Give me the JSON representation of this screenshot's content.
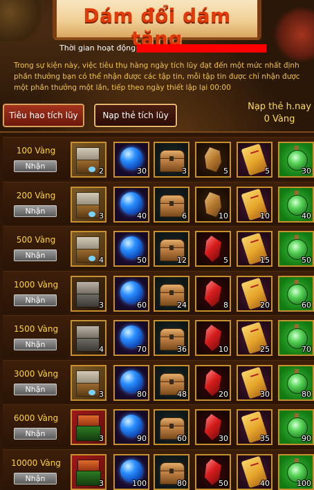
{
  "header": {
    "title": "Dám đổi dám tặng",
    "time_label": "Thời gian hoạt động:",
    "time_value": "",
    "description": "Trong sự kiện này, việc tiêu thụ hàng ngày tích lũy đạt đến một mức nhất định phần thưởng bạn có thể nhận được các tập tin, mỗi tập tin được chỉ nhận được một phần thưởng một lần, tiếp theo ngày thiết lập lại 00:00"
  },
  "tabs": [
    {
      "label": "Tiêu hao tích lũy",
      "active": false
    },
    {
      "label": "Nạp thẻ tích lũy",
      "active": true
    }
  ],
  "nap_info": {
    "line1": "Nạp thẻ h.nay",
    "line2": "0 Vàng"
  },
  "colors": {
    "amount": "#ffd33a",
    "desc": "#f0c24b",
    "title": "#e23b0b",
    "slot_border": "#c9912e"
  },
  "rows": [
    {
      "amount": "100 Vàng",
      "button": "Nhận",
      "counts": [
        "2",
        "30",
        "3",
        "5",
        "5",
        "30"
      ]
    },
    {
      "amount": "200 Vàng",
      "button": "Nhận",
      "counts": [
        "3",
        "40",
        "6",
        "10",
        "10",
        "40"
      ]
    },
    {
      "amount": "500 Vàng",
      "button": "Nhận",
      "counts": [
        "4",
        "50",
        "12",
        "5",
        "15",
        "50"
      ]
    },
    {
      "amount": "1000 Vàng",
      "button": "Nhận",
      "counts": [
        "3",
        "60",
        "24",
        "8",
        "20",
        "60"
      ]
    },
    {
      "amount": "1500 Vàng",
      "button": "Nhận",
      "counts": [
        "4",
        "70",
        "36",
        "10",
        "25",
        "70"
      ]
    },
    {
      "amount": "3000 Vàng",
      "button": "Nhận",
      "counts": [
        "3",
        "80",
        "48",
        "20",
        "30",
        "80"
      ]
    },
    {
      "amount": "6000 Vàng",
      "button": "Nhận",
      "counts": [
        "3",
        "90",
        "60",
        "30",
        "35",
        "90"
      ]
    },
    {
      "amount": "10000 Vàng",
      "button": "Nhận",
      "counts": [
        "3",
        "100",
        "80",
        "50",
        "40",
        "100"
      ]
    }
  ],
  "row_icons": [
    [
      "gift-box-icon",
      "blue-orb-icon",
      "treasure-chest-icon",
      "amber-stone-icon",
      "scroll-icon",
      "green-potion-icon"
    ],
    [
      "gift-box-icon",
      "blue-orb-icon",
      "treasure-chest-icon",
      "amber-stone-icon",
      "scroll-icon",
      "green-potion-icon"
    ],
    [
      "gift-box-icon",
      "blue-orb-icon",
      "treasure-chest-icon",
      "red-crystal-icon",
      "scroll-icon",
      "green-potion-icon"
    ],
    [
      "dark-gift-box-icon",
      "blue-orb-icon",
      "treasure-chest-icon",
      "red-crystal-icon",
      "scroll-icon",
      "green-potion-icon"
    ],
    [
      "dark-gift-box-icon",
      "blue-orb-icon",
      "treasure-chest-icon",
      "red-crystal-icon",
      "scroll-icon",
      "green-potion-icon"
    ],
    [
      "gift-box-icon",
      "blue-orb-icon",
      "treasure-chest-icon",
      "red-crystal-icon",
      "scroll-icon",
      "green-potion-icon"
    ],
    [
      "red-gift-box-icon",
      "blue-orb-icon",
      "treasure-chest-icon",
      "red-crystal-icon",
      "scroll-icon",
      "green-potion-icon"
    ],
    [
      "red-gift-box-icon",
      "blue-orb-icon",
      "treasure-chest-icon",
      "red-crystal-icon",
      "scroll-icon",
      "green-potion-icon"
    ]
  ]
}
